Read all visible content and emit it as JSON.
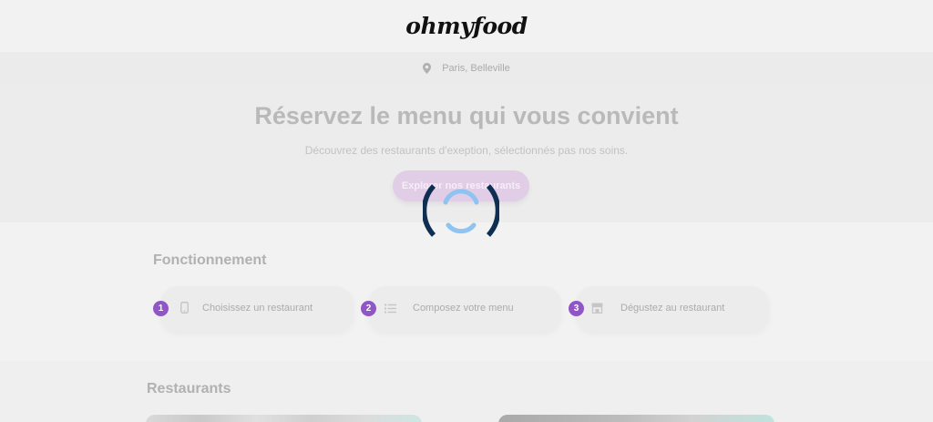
{
  "header": {
    "logo": "ohmyfood"
  },
  "location": {
    "icon": "map-pin-icon",
    "text": "Paris, Belleville"
  },
  "hero": {
    "title": "Réservez le menu qui vous convient",
    "subtitle": "Découvrez des restaurants d'exeption, sélectionnés pas nos soins.",
    "cta_label": "Explorer nos restaurants"
  },
  "how": {
    "title": "Fonctionnement",
    "steps": [
      {
        "number": "1",
        "icon": "phone-icon",
        "label": "Choisissez un restaurant"
      },
      {
        "number": "2",
        "icon": "list-icon",
        "label": "Composez votre menu"
      },
      {
        "number": "3",
        "icon": "store-icon",
        "label": "Dégustez au restaurant"
      }
    ]
  },
  "restaurants": {
    "title": "Restaurants"
  },
  "loader": {
    "icon": "loading-spinner-icon"
  },
  "colors": {
    "accent": "#9056c8",
    "cta_bg": "#e2cde6",
    "spinner_outer": "#0f2f52",
    "spinner_inner": "#8ec3f2"
  }
}
